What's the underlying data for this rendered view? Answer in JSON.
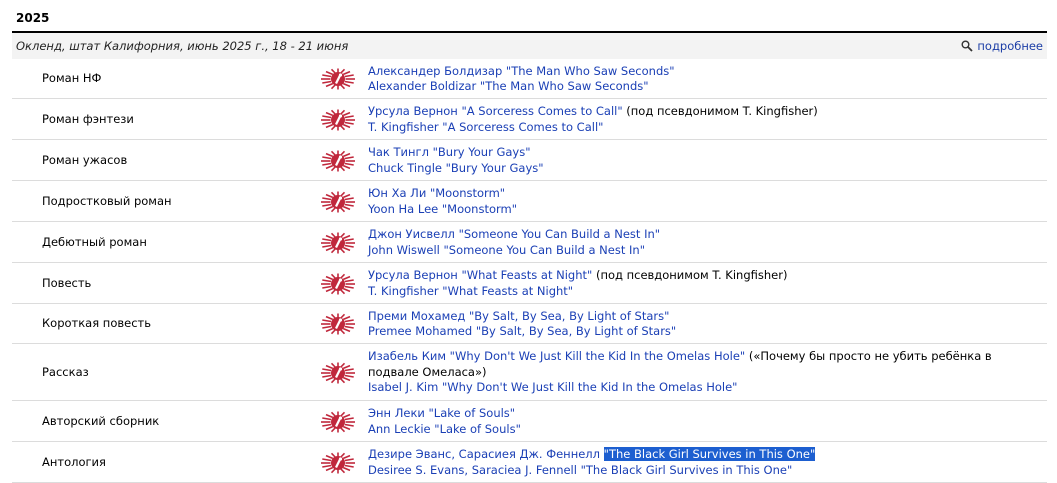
{
  "year": "2025",
  "event": {
    "info": "Окленд, штат Калифорния, июнь 2025 г., 18 - 21 июня",
    "more_label": "подробнее"
  },
  "rows": [
    {
      "category": "Роман НФ",
      "lines": [
        {
          "link": "Александер Болдизар \"The Man Who Saw Seconds\"",
          "note": ""
        },
        {
          "link": "Alexander Boldizar \"The Man Who Saw Seconds\"",
          "note": ""
        }
      ]
    },
    {
      "category": "Роман фэнтези",
      "lines": [
        {
          "link": "Урсула Вернон \"A Sorceress Comes to Call\"",
          "note": " (под псевдонимом T. Kingfisher)"
        },
        {
          "link": "T. Kingfisher \"A Sorceress Comes to Call\"",
          "note": ""
        }
      ]
    },
    {
      "category": "Роман ужасов",
      "lines": [
        {
          "link": "Чак Тингл \"Bury Your Gays\"",
          "note": ""
        },
        {
          "link": "Chuck Tingle \"Bury Your Gays\"",
          "note": ""
        }
      ]
    },
    {
      "category": "Подростковый роман",
      "lines": [
        {
          "link": "Юн Ха Ли \"Moonstorm\"",
          "note": ""
        },
        {
          "link": "Yoon Ha Lee \"Moonstorm\"",
          "note": ""
        }
      ]
    },
    {
      "category": "Дебютный роман",
      "lines": [
        {
          "link": "Джон Уисвелл \"Someone You Can Build a Nest In\"",
          "note": ""
        },
        {
          "link": "John Wiswell \"Someone You Can Build a Nest In\"",
          "note": ""
        }
      ]
    },
    {
      "category": "Повесть",
      "lines": [
        {
          "link": "Урсула Вернон \"What Feasts at Night\"",
          "note": " (под псевдонимом T. Kingfisher)"
        },
        {
          "link": "T. Kingfisher \"What Feasts at Night\"",
          "note": ""
        }
      ]
    },
    {
      "category": "Короткая повесть",
      "lines": [
        {
          "link": "Преми Мохамед \"By Salt, By Sea, By Light of Stars\"",
          "note": ""
        },
        {
          "link": "Premee Mohamed \"By Salt, By Sea, By Light of Stars\"",
          "note": ""
        }
      ]
    },
    {
      "category": "Рассказ",
      "lines": [
        {
          "link": "Изабель Ким \"Why Don't We Just Kill the Kid In the Omelas Hole\"",
          "note": " («Почему бы просто не убить ребёнка в подвале Омеласа»)"
        },
        {
          "link": "Isabel J. Kim \"Why Don't We Just Kill the Kid In the Omelas Hole\"",
          "note": ""
        }
      ]
    },
    {
      "category": "Авторский сборник",
      "lines": [
        {
          "link": "Энн Леки \"Lake of Souls\"",
          "note": ""
        },
        {
          "link": "Ann Leckie \"Lake of Souls\"",
          "note": ""
        }
      ]
    },
    {
      "category": "Антология",
      "lines": [
        {
          "link": "Дезире Эванс, Сарасиея Дж. Феннелл ",
          "hl": "\"The Black Girl Survives in This One\"",
          "note": ""
        },
        {
          "link": "Desiree S. Evans, Saraciea J. Fennell \"The Black Girl Survives in This One\"",
          "note": ""
        }
      ]
    }
  ],
  "colors": {
    "link": "#1a3fb5",
    "highlight": "#1d5fd0",
    "award_icon": "#c0283c"
  }
}
